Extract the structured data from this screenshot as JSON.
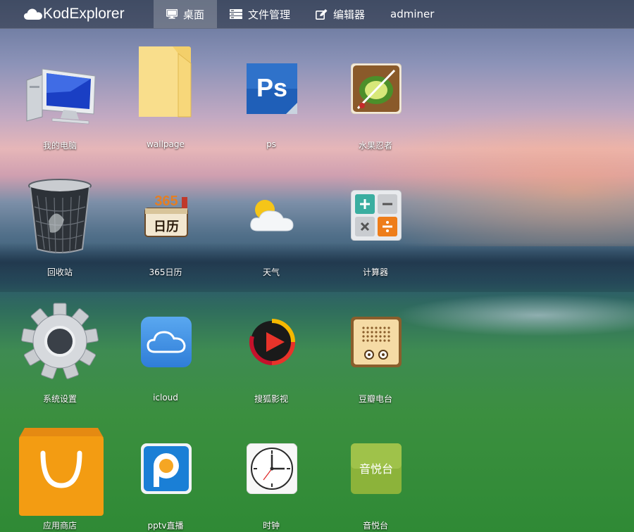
{
  "app": {
    "logo_text": "KodExplorer"
  },
  "nav": {
    "items": [
      {
        "label": "桌面",
        "icon": "desktop-icon",
        "active": true
      },
      {
        "label": "文件管理",
        "icon": "file-manager-icon",
        "active": false
      },
      {
        "label": "编辑器",
        "icon": "editor-icon",
        "active": false
      },
      {
        "label": "adminer",
        "icon": "",
        "active": false
      }
    ]
  },
  "desktop": {
    "apps": [
      {
        "label": "我的电脑",
        "icon": "computer-icon"
      },
      {
        "label": "wallpage",
        "icon": "folder-icon"
      },
      {
        "label": "ps",
        "icon": "photoshop-icon"
      },
      {
        "label": "水果忍者",
        "icon": "fruit-ninja-icon"
      },
      {
        "label": "回收站",
        "icon": "recycle-bin-icon"
      },
      {
        "label": "365日历",
        "icon": "calendar-365-icon"
      },
      {
        "label": "天气",
        "icon": "weather-icon"
      },
      {
        "label": "计算器",
        "icon": "calculator-icon"
      },
      {
        "label": "系统设置",
        "icon": "gear-icon"
      },
      {
        "label": "icloud",
        "icon": "icloud-icon"
      },
      {
        "label": "搜狐影视",
        "icon": "sohu-video-icon"
      },
      {
        "label": "豆瓣电台",
        "icon": "douban-radio-icon"
      },
      {
        "label": "应用商店",
        "icon": "app-store-bag-icon"
      },
      {
        "label": "pptv直播",
        "icon": "pptv-icon"
      },
      {
        "label": "时钟",
        "icon": "clock-icon"
      },
      {
        "label": "音悦台",
        "icon": "yinyuetai-icon"
      }
    ],
    "badge_ps": "Ps",
    "calendar_number": "365",
    "calendar_text": "日历",
    "yinyuetai_text": "音悦台"
  },
  "colors": {
    "topbar": "#28303c",
    "folder": "#f7d77a",
    "ps_blue": "#1f5fb8",
    "icloud_blue": "#3d8be0",
    "bag_orange": "#f39c12"
  }
}
